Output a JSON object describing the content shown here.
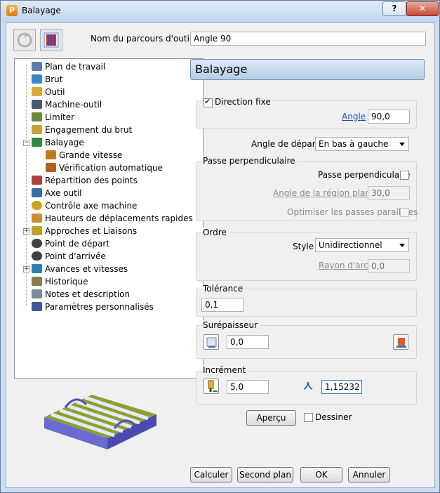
{
  "window": {
    "title": "Balayage",
    "app_icon": "P",
    "help_label": "?",
    "close_label": "✕"
  },
  "toolpath_name": {
    "label": "Nom du parcours d'outil",
    "value": "Angle 90"
  },
  "tree": {
    "items": [
      {
        "label": "Plan de travail",
        "icon": "workplane-icon",
        "color": "#5a7ca8"
      },
      {
        "label": "Brut",
        "icon": "block-icon",
        "color": "#3b86c4"
      },
      {
        "label": "Outil",
        "icon": "tool-icon",
        "color": "#d8a83a"
      },
      {
        "label": "Machine-outil",
        "icon": "machine-tool-icon",
        "color": "#4a5a6a"
      },
      {
        "label": "Limiter",
        "icon": "limit-icon",
        "color": "#6a8a3a"
      },
      {
        "label": "Engagement du brut",
        "icon": "stock-engagement-icon",
        "color": "#c8a030"
      },
      {
        "label": "Balayage",
        "icon": "raster-icon",
        "color": "#2f8a3f"
      },
      {
        "label": "Grande vitesse",
        "icon": "high-speed-icon",
        "color": "#c07a20"
      },
      {
        "label": "Vérification automatique",
        "icon": "auto-verify-icon",
        "color": "#b06020"
      },
      {
        "label": "Répartition des points",
        "icon": "point-distribution-icon",
        "color": "#b04040"
      },
      {
        "label": "Axe outil",
        "icon": "tool-axis-icon",
        "color": "#3a6aa8"
      },
      {
        "label": "Contrôle axe machine",
        "icon": "axis-control-icon",
        "color": "#d0a020"
      },
      {
        "label": "Hauteurs de déplacements rapides",
        "icon": "rapid-move-heights-icon",
        "color": "#c89030"
      },
      {
        "label": "Approches et Liaisons",
        "icon": "leads-links-icon",
        "color": "#c0a020"
      },
      {
        "label": "Point de départ",
        "icon": "start-point-icon",
        "color": "#404040"
      },
      {
        "label": "Point d'arrivée",
        "icon": "end-point-icon",
        "color": "#404040"
      },
      {
        "label": "Avances et vitesses",
        "icon": "feeds-speeds-icon",
        "color": "#2f7fb0"
      },
      {
        "label": "Historique",
        "icon": "history-icon",
        "color": "#8a7a50"
      },
      {
        "label": "Notes et description",
        "icon": "notes-icon",
        "color": "#7a8a9a"
      },
      {
        "label": "Paramètres personnalisés",
        "icon": "user-params-icon",
        "color": "#3a5a9a"
      }
    ]
  },
  "panel": {
    "title": "Balayage",
    "fixed_direction": {
      "label": "Direction fixe",
      "checked": true
    },
    "angle": {
      "label": "Angle",
      "value": "90,0"
    },
    "start_corner": {
      "label": "Angle de départ",
      "value": "En bas à gauche"
    },
    "perpendicular": {
      "group_title": "Passe perpendiculaire",
      "checkbox_label": "Passe perpendiculaire",
      "checked": false,
      "flat_angle_label": "Angle de la région plane",
      "flat_angle_value": "30,0",
      "optimise_label": "Optimiser les passes parallèles"
    },
    "ordering": {
      "group_title": "Ordre",
      "style_label": "Style",
      "style_value": "Unidirectionnel",
      "arc_radius_label": "Rayon d'arc",
      "arc_radius_value": "0,0"
    },
    "tolerance": {
      "group_title": "Tolérance",
      "value": "0,1"
    },
    "thickness": {
      "group_title": "Surépaisseur",
      "value": "0,0"
    },
    "stepover": {
      "group_title": "Incrément",
      "value": "5,0",
      "cusp_value": "1,15232"
    },
    "preview_button": "Aperçu",
    "draw": {
      "label": "Dessiner",
      "checked": false
    }
  },
  "footer": {
    "calculate": "Calculer",
    "queue": "Second plan",
    "ok": "OK",
    "cancel": "Annuler"
  }
}
